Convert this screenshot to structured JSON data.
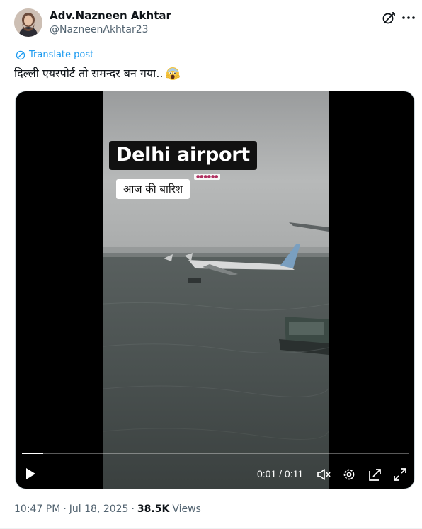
{
  "author": {
    "name": "Adv.Nazneen Akhtar",
    "handle": "@NazneenAkhtar23"
  },
  "icons": {
    "grok": "grok-icon",
    "more": "more-icon",
    "translate": "globe-icon",
    "emoji": "face-screaming-in-fear-emoji"
  },
  "post": {
    "translate_label": "Translate post",
    "text": "दिल्ली एयरपोर्ट तो समन्दर बन गया.."
  },
  "video": {
    "overlay_title": "Delhi airport",
    "overlay_subtitle": "आज की बारिश",
    "time_display": "0:01 / 0:11",
    "progress_fraction": 0.055
  },
  "meta": {
    "time": "10:47 PM",
    "sep1": "·",
    "date": "Jul 18, 2025",
    "sep2": "·",
    "views_count": "38.5K",
    "views_label": "Views"
  },
  "colors": {
    "link": "#1d9bf0",
    "secondary_text": "#536471",
    "primary_text": "#0f1419"
  }
}
